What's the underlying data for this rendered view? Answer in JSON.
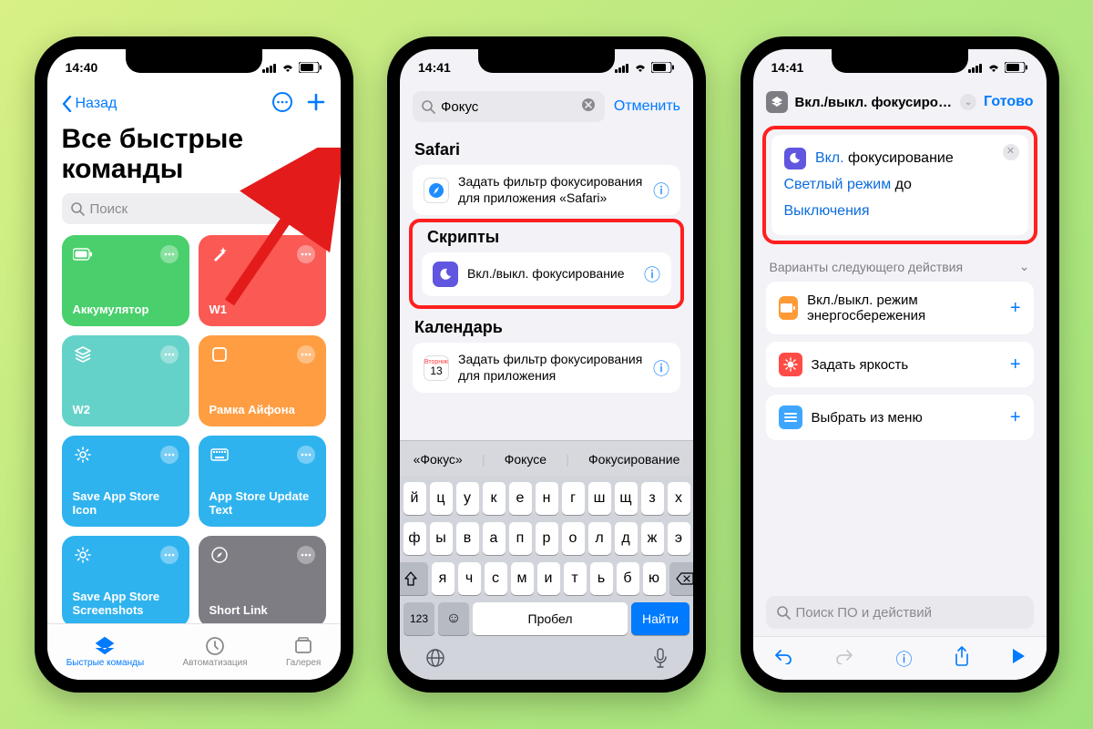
{
  "status": {
    "time1": "14:40",
    "time2": "14:41",
    "time3": "14:41",
    "battery": "71"
  },
  "p1": {
    "back": "Назад",
    "title": "Все быстрые команды",
    "search_ph": "Поиск",
    "tiles": [
      {
        "label": "Аккумулятор"
      },
      {
        "label": "W1"
      },
      {
        "label": "W2"
      },
      {
        "label": "Рамка Айфона"
      },
      {
        "label": "Save App Store Icon"
      },
      {
        "label": "App Store Update Text"
      },
      {
        "label": "Save App Store Screenshots"
      },
      {
        "label": "Short Link"
      }
    ],
    "tabs": {
      "shortcuts": "Быстрые команды",
      "automation": "Автоматизация",
      "gallery": "Галерея"
    }
  },
  "p2": {
    "query": "Фокус",
    "cancel": "Отменить",
    "sec_safari": "Safari",
    "safari_action": "Задать фильтр фокусирования для приложения «Safari»",
    "sec_scripts": "Скрипты",
    "script_action": "Вкл./выкл. фокусирование",
    "sec_calendar": "Календарь",
    "cal_day": "13",
    "cal_wd": "Вторник",
    "cal_action": "Задать фильтр фокусирования для приложения",
    "sugg": [
      "«Фокус»",
      "Фокусе",
      "Фокусирование"
    ],
    "keys_r1": [
      "й",
      "ц",
      "у",
      "к",
      "е",
      "н",
      "г",
      "ш",
      "щ",
      "з",
      "х"
    ],
    "keys_r2": [
      "ф",
      "ы",
      "в",
      "а",
      "п",
      "р",
      "о",
      "л",
      "д",
      "ж",
      "э"
    ],
    "keys_r3": [
      "я",
      "ч",
      "с",
      "м",
      "и",
      "т",
      "ь",
      "б",
      "ю"
    ],
    "k123": "123",
    "space": "Пробел",
    "find": "Найти"
  },
  "p3": {
    "title": "Вкл./выкл. фокусирован…",
    "done": "Готово",
    "tok_on": "Вкл.",
    "tok_focus": "фокусирование",
    "tok_mode": "Светлый режим",
    "tok_until": "до",
    "tok_off": "Выключения",
    "next_header": "Варианты следующего действия",
    "sugs": [
      {
        "label": "Вкл./выкл. режим энергосбережения",
        "color": "#ff9b36"
      },
      {
        "label": "Задать яркость",
        "color": "#ff4b46"
      },
      {
        "label": "Выбрать из меню",
        "color": "#3fa6ff"
      }
    ],
    "search_ph": "Поиск ПО и действий"
  }
}
